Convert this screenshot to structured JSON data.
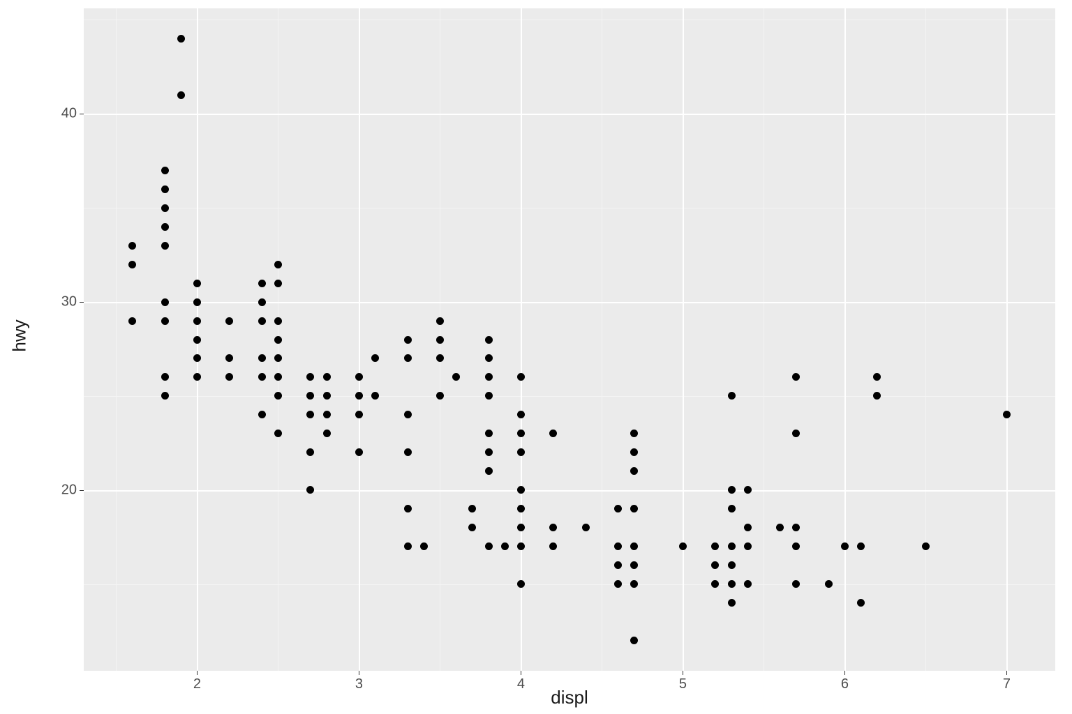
{
  "chart_data": {
    "type": "scatter",
    "xlabel": "displ",
    "ylabel": "hwy",
    "xlim": [
      1.3,
      7.3
    ],
    "ylim": [
      10.4,
      45.6
    ],
    "x_ticks": [
      2,
      3,
      4,
      5,
      6,
      7
    ],
    "y_ticks": [
      20,
      30,
      40
    ],
    "x_minor": [
      1.5,
      2.5,
      3.5,
      4.5,
      5.5,
      6.5
    ],
    "y_minor": [
      15,
      25,
      35,
      45
    ],
    "series": [
      {
        "name": "points",
        "points": [
          {
            "x": 1.6,
            "y": 33
          },
          {
            "x": 1.6,
            "y": 32
          },
          {
            "x": 1.6,
            "y": 29
          },
          {
            "x": 1.8,
            "y": 37
          },
          {
            "x": 1.8,
            "y": 36
          },
          {
            "x": 1.8,
            "y": 35
          },
          {
            "x": 1.8,
            "y": 34
          },
          {
            "x": 1.8,
            "y": 33
          },
          {
            "x": 1.8,
            "y": 30
          },
          {
            "x": 1.8,
            "y": 29
          },
          {
            "x": 1.8,
            "y": 26
          },
          {
            "x": 1.8,
            "y": 25
          },
          {
            "x": 1.9,
            "y": 44
          },
          {
            "x": 1.9,
            "y": 41
          },
          {
            "x": 2.0,
            "y": 31
          },
          {
            "x": 2.0,
            "y": 30
          },
          {
            "x": 2.0,
            "y": 29
          },
          {
            "x": 2.0,
            "y": 28
          },
          {
            "x": 2.0,
            "y": 27
          },
          {
            "x": 2.0,
            "y": 26
          },
          {
            "x": 2.2,
            "y": 29
          },
          {
            "x": 2.2,
            "y": 27
          },
          {
            "x": 2.2,
            "y": 26
          },
          {
            "x": 2.4,
            "y": 31
          },
          {
            "x": 2.4,
            "y": 30
          },
          {
            "x": 2.4,
            "y": 29
          },
          {
            "x": 2.4,
            "y": 27
          },
          {
            "x": 2.4,
            "y": 26
          },
          {
            "x": 2.4,
            "y": 24
          },
          {
            "x": 2.5,
            "y": 32
          },
          {
            "x": 2.5,
            "y": 31
          },
          {
            "x": 2.5,
            "y": 29
          },
          {
            "x": 2.5,
            "y": 28
          },
          {
            "x": 2.5,
            "y": 27
          },
          {
            "x": 2.5,
            "y": 26
          },
          {
            "x": 2.5,
            "y": 25
          },
          {
            "x": 2.5,
            "y": 23
          },
          {
            "x": 2.7,
            "y": 26
          },
          {
            "x": 2.7,
            "y": 25
          },
          {
            "x": 2.7,
            "y": 24
          },
          {
            "x": 2.7,
            "y": 22
          },
          {
            "x": 2.7,
            "y": 20
          },
          {
            "x": 2.8,
            "y": 26
          },
          {
            "x": 2.8,
            "y": 25
          },
          {
            "x": 2.8,
            "y": 24
          },
          {
            "x": 2.8,
            "y": 23
          },
          {
            "x": 3.0,
            "y": 26
          },
          {
            "x": 3.0,
            "y": 25
          },
          {
            "x": 3.0,
            "y": 24
          },
          {
            "x": 3.0,
            "y": 22
          },
          {
            "x": 3.1,
            "y": 27
          },
          {
            "x": 3.1,
            "y": 25
          },
          {
            "x": 3.3,
            "y": 28
          },
          {
            "x": 3.3,
            "y": 27
          },
          {
            "x": 3.3,
            "y": 24
          },
          {
            "x": 3.3,
            "y": 22
          },
          {
            "x": 3.3,
            "y": 19
          },
          {
            "x": 3.3,
            "y": 17
          },
          {
            "x": 3.4,
            "y": 17
          },
          {
            "x": 3.5,
            "y": 29
          },
          {
            "x": 3.5,
            "y": 28
          },
          {
            "x": 3.5,
            "y": 27
          },
          {
            "x": 3.5,
            "y": 25
          },
          {
            "x": 3.6,
            "y": 26
          },
          {
            "x": 3.7,
            "y": 19
          },
          {
            "x": 3.7,
            "y": 18
          },
          {
            "x": 3.8,
            "y": 28
          },
          {
            "x": 3.8,
            "y": 27
          },
          {
            "x": 3.8,
            "y": 26
          },
          {
            "x": 3.8,
            "y": 25
          },
          {
            "x": 3.8,
            "y": 23
          },
          {
            "x": 3.8,
            "y": 22
          },
          {
            "x": 3.8,
            "y": 21
          },
          {
            "x": 3.8,
            "y": 17
          },
          {
            "x": 3.9,
            "y": 17
          },
          {
            "x": 4.0,
            "y": 26
          },
          {
            "x": 4.0,
            "y": 24
          },
          {
            "x": 4.0,
            "y": 23
          },
          {
            "x": 4.0,
            "y": 22
          },
          {
            "x": 4.0,
            "y": 20
          },
          {
            "x": 4.0,
            "y": 19
          },
          {
            "x": 4.0,
            "y": 18
          },
          {
            "x": 4.0,
            "y": 17
          },
          {
            "x": 4.0,
            "y": 15
          },
          {
            "x": 4.2,
            "y": 23
          },
          {
            "x": 4.2,
            "y": 18
          },
          {
            "x": 4.2,
            "y": 17
          },
          {
            "x": 4.4,
            "y": 18
          },
          {
            "x": 4.6,
            "y": 19
          },
          {
            "x": 4.6,
            "y": 17
          },
          {
            "x": 4.6,
            "y": 16
          },
          {
            "x": 4.6,
            "y": 15
          },
          {
            "x": 4.7,
            "y": 23
          },
          {
            "x": 4.7,
            "y": 22
          },
          {
            "x": 4.7,
            "y": 21
          },
          {
            "x": 4.7,
            "y": 19
          },
          {
            "x": 4.7,
            "y": 17
          },
          {
            "x": 4.7,
            "y": 16
          },
          {
            "x": 4.7,
            "y": 15
          },
          {
            "x": 4.7,
            "y": 12
          },
          {
            "x": 5.0,
            "y": 17
          },
          {
            "x": 5.2,
            "y": 17
          },
          {
            "x": 5.2,
            "y": 16
          },
          {
            "x": 5.2,
            "y": 15
          },
          {
            "x": 5.3,
            "y": 25
          },
          {
            "x": 5.3,
            "y": 20
          },
          {
            "x": 5.3,
            "y": 19
          },
          {
            "x": 5.3,
            "y": 17
          },
          {
            "x": 5.3,
            "y": 16
          },
          {
            "x": 5.3,
            "y": 15
          },
          {
            "x": 5.3,
            "y": 14
          },
          {
            "x": 5.4,
            "y": 20
          },
          {
            "x": 5.4,
            "y": 18
          },
          {
            "x": 5.4,
            "y": 17
          },
          {
            "x": 5.4,
            "y": 15
          },
          {
            "x": 5.6,
            "y": 18
          },
          {
            "x": 5.7,
            "y": 26
          },
          {
            "x": 5.7,
            "y": 23
          },
          {
            "x": 5.7,
            "y": 18
          },
          {
            "x": 5.7,
            "y": 17
          },
          {
            "x": 5.7,
            "y": 15
          },
          {
            "x": 5.9,
            "y": 15
          },
          {
            "x": 6.0,
            "y": 17
          },
          {
            "x": 6.1,
            "y": 17
          },
          {
            "x": 6.1,
            "y": 14
          },
          {
            "x": 6.2,
            "y": 26
          },
          {
            "x": 6.2,
            "y": 25
          },
          {
            "x": 6.5,
            "y": 17
          },
          {
            "x": 7.0,
            "y": 24
          }
        ]
      }
    ]
  }
}
